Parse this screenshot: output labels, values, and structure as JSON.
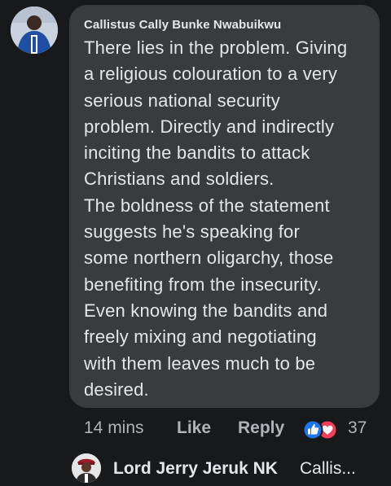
{
  "comment": {
    "author": "Callistus Cally Bunke Nwabuikwu",
    "body_lines": [
      "There lies in the problem. Giving",
      "a religious colouration to a very",
      "serious national security",
      "problem.  Directly and indirectly",
      "inciting the bandits to attack",
      "Christians and soldiers.",
      "The boldness of the statement",
      "suggests he's speaking for",
      "some northern oligarchy, those",
      "benefiting from the insecurity.",
      "Even knowing the bandits and",
      "freely mixing and negotiating",
      "with them leaves much to be",
      "desired."
    ],
    "timestamp": "14 mins",
    "like_label": "Like",
    "reply_label": "Reply",
    "reaction_count": "37",
    "reaction_icons": [
      "like-reaction-icon",
      "love-reaction-icon"
    ]
  },
  "reply": {
    "author": "Lord Jerry Jeruk NK",
    "preview": "Callis..."
  },
  "colors": {
    "background": "#18191a",
    "bubble": "#3a3b3c",
    "text_primary": "#e4e6eb",
    "text_secondary": "#b0b3b8",
    "like_blue": "#1877f2",
    "love_red": "#f33e58"
  }
}
